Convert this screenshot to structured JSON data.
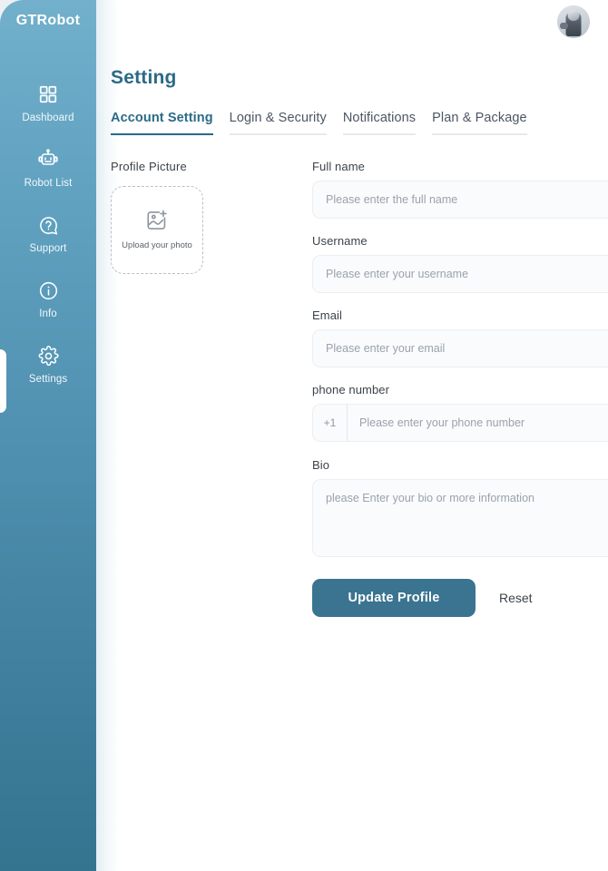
{
  "sidebar": {
    "brand": "GTRobot",
    "items": [
      {
        "label": "Dashboard",
        "icon": "grid-icon",
        "active": false
      },
      {
        "label": "Robot List",
        "icon": "robot-icon",
        "active": false
      },
      {
        "label": "Support",
        "icon": "question-circle-icon",
        "active": false
      },
      {
        "label": "Info",
        "icon": "info-circle-icon",
        "active": false
      },
      {
        "label": "Settings",
        "icon": "gear-icon",
        "active": true
      }
    ]
  },
  "topbar": {
    "avatar_alt": "user-avatar-photo"
  },
  "header": {
    "title": "Setting"
  },
  "tabs": [
    {
      "label": "Account Setting",
      "active": true
    },
    {
      "label": "Login & Security",
      "active": false
    },
    {
      "label": "Notifications",
      "active": false
    },
    {
      "label": "Plan & Package",
      "active": false
    }
  ],
  "profile_picture": {
    "label": "Profile Picture",
    "upload_text": "Upload your photo",
    "icon": "image-plus-icon"
  },
  "form": {
    "full_name": {
      "label": "Full name",
      "value": "",
      "placeholder": "Please enter the full name"
    },
    "username": {
      "label": "Username",
      "value": "",
      "placeholder": "Please enter your username"
    },
    "email": {
      "label": "Email",
      "value": "",
      "placeholder": "Please enter your email"
    },
    "phone": {
      "label": "phone number",
      "country_code": "+1",
      "value": "",
      "placeholder": "Please enter your phone number"
    },
    "bio": {
      "label": "Bio",
      "value": "",
      "placeholder": "please Enter your bio or more information"
    }
  },
  "actions": {
    "update_label": "Update Profile",
    "reset_label": "Reset"
  },
  "colors": {
    "accent": "#3a7490",
    "title": "#2b6a87",
    "sidebar_top": "#72b0cb",
    "sidebar_bottom": "#35748f",
    "input_bg": "#fafbfc",
    "page_bg": "#eceff3"
  }
}
